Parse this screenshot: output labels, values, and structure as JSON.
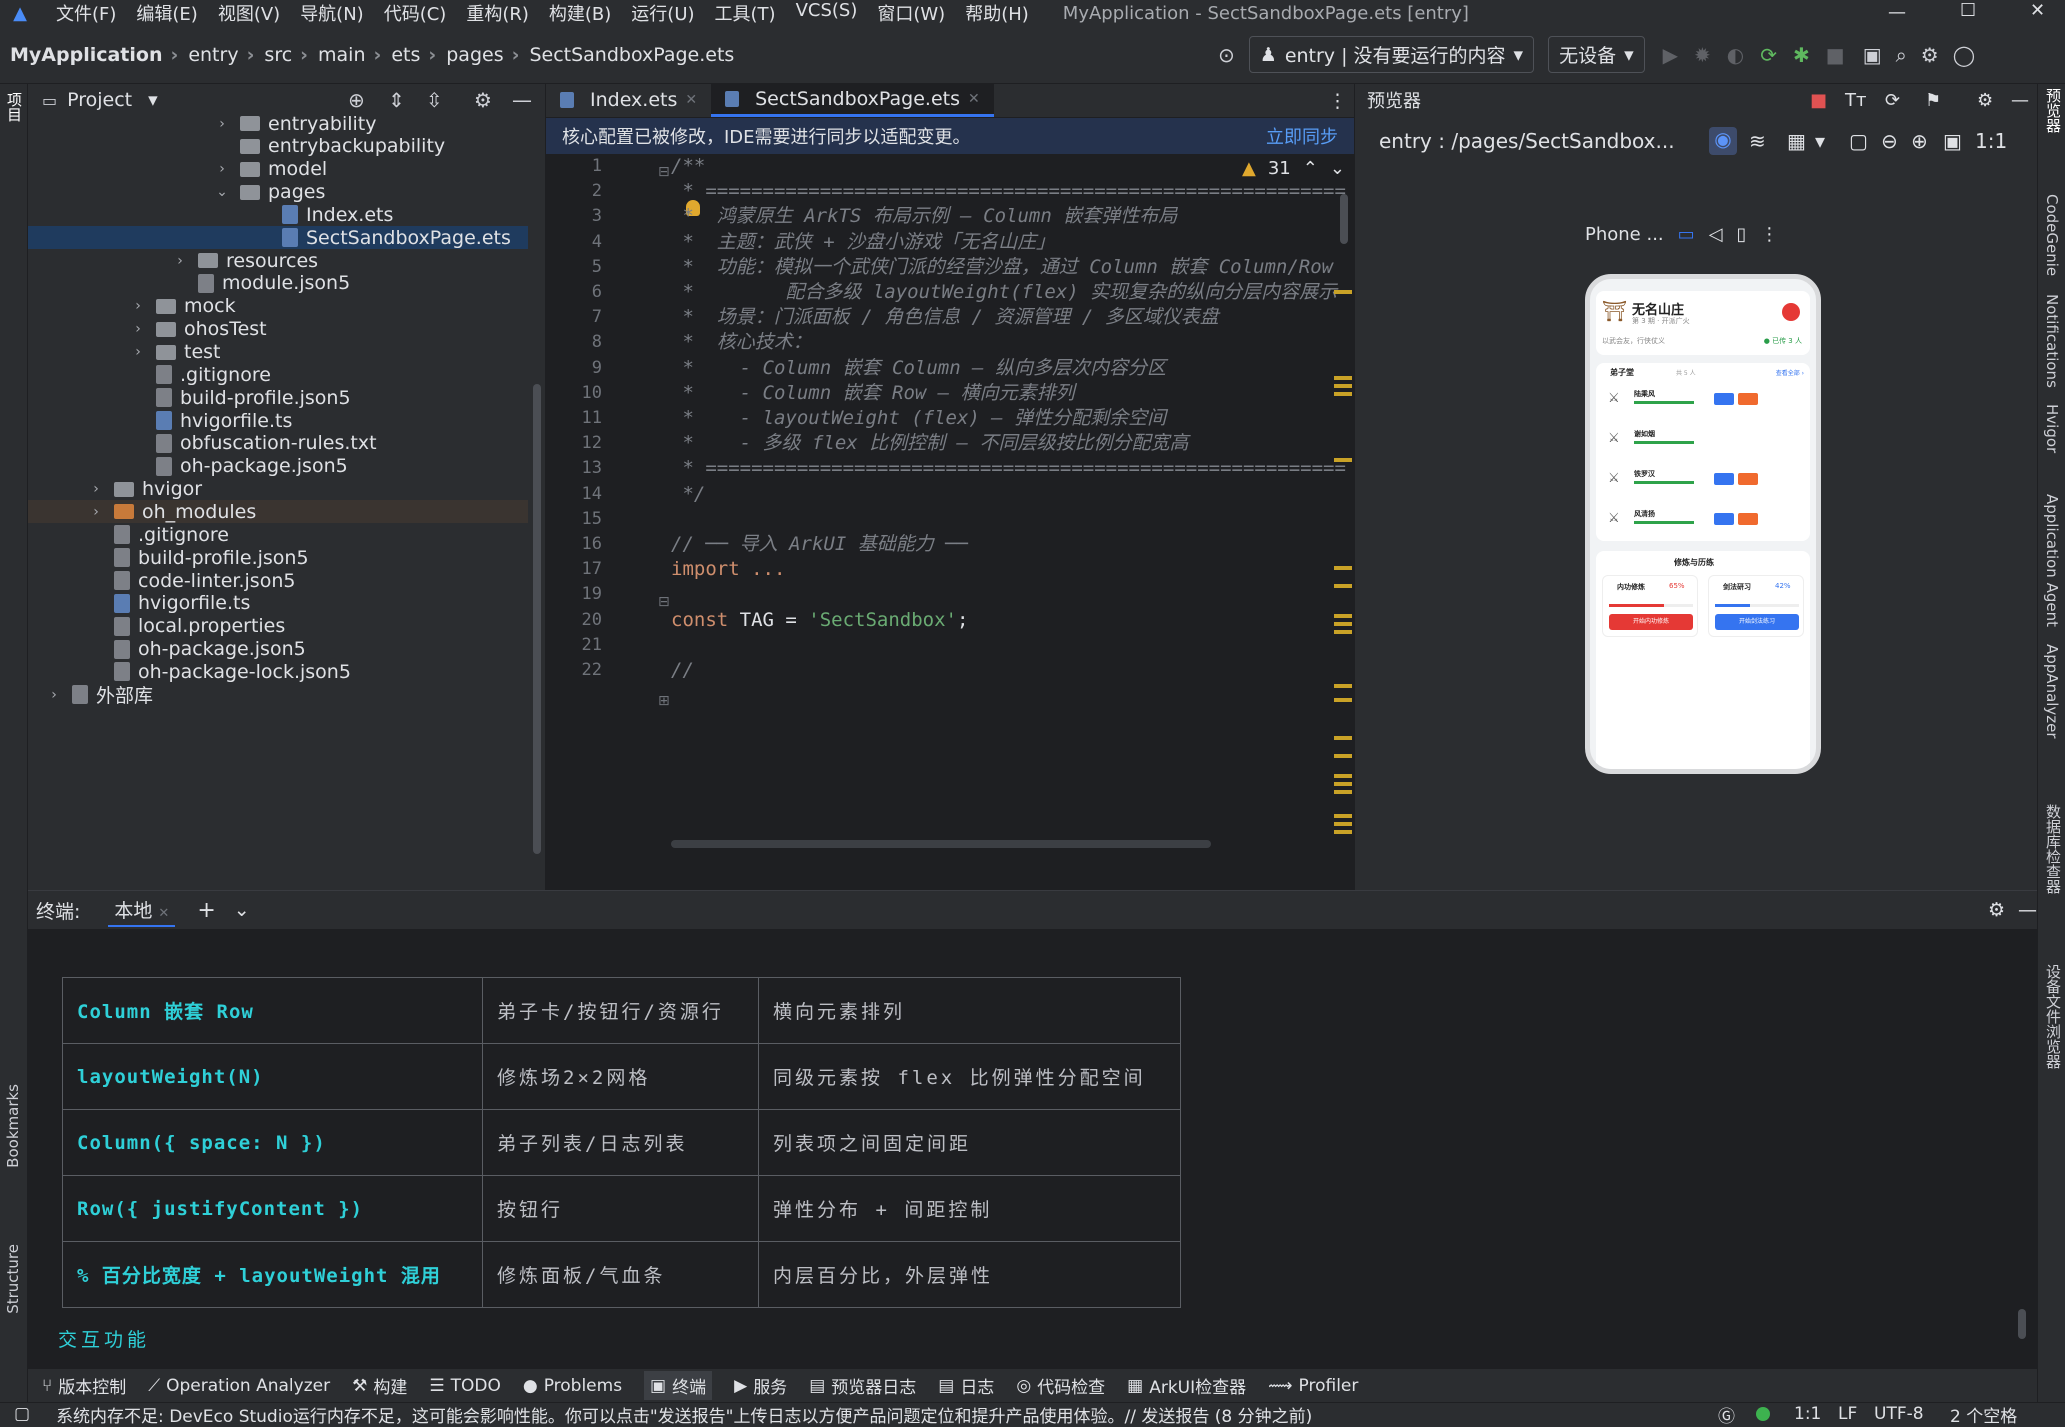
{
  "title_bar": {
    "menus": [
      "文件(F)",
      "编辑(E)",
      "视图(V)",
      "导航(N)",
      "代码(C)",
      "重构(R)",
      "构建(B)",
      "运行(U)",
      "工具(T)",
      "VCS(S)",
      "窗口(W)",
      "帮助(H)"
    ],
    "window_title": "MyApplication - SectSandboxPage.ets [entry]"
  },
  "nav_bar": {
    "breadcrumbs": [
      "MyApplication",
      "entry",
      "src",
      "main",
      "ets",
      "pages",
      "SectSandboxPage.ets"
    ],
    "run_config": "entry | 没有要运行的内容",
    "device": "无设备"
  },
  "left_strip": {
    "project_label": "项目",
    "bookmarks_label": "Bookmarks",
    "structure_label": "Structure"
  },
  "right_strip": {
    "items": [
      "预览器",
      "CodeGenie",
      "Notifications",
      "Hvigor",
      "Application Agent",
      "AppAnalyzer",
      "数据库检查器",
      "设备文件浏览器"
    ]
  },
  "project_panel": {
    "title": "Project",
    "tree": [
      {
        "label": "entryability",
        "type": "folder",
        "depth": 3,
        "expanded": false
      },
      {
        "label": "entrybackupability",
        "type": "folder",
        "depth": 3,
        "expanded": null
      },
      {
        "label": "model",
        "type": "folder",
        "depth": 3,
        "expanded": false
      },
      {
        "label": "pages",
        "type": "folder",
        "depth": 3,
        "expanded": true
      },
      {
        "label": "Index.ets",
        "type": "file",
        "depth": 4
      },
      {
        "label": "SectSandboxPage.ets",
        "type": "file",
        "depth": 4,
        "selected": true
      },
      {
        "label": "resources",
        "type": "folder",
        "depth": 2,
        "expanded": false
      },
      {
        "label": "module.json5",
        "type": "file-g",
        "depth": 2
      },
      {
        "label": "mock",
        "type": "folder",
        "depth": 1,
        "expanded": false
      },
      {
        "label": "ohosTest",
        "type": "folder",
        "depth": 1,
        "expanded": false
      },
      {
        "label": "test",
        "type": "folder",
        "depth": 1,
        "expanded": false
      },
      {
        "label": ".gitignore",
        "type": "file-g",
        "depth": 1
      },
      {
        "label": "build-profile.json5",
        "type": "file-g",
        "depth": 1
      },
      {
        "label": "hvigorfile.ts",
        "type": "file",
        "depth": 1
      },
      {
        "label": "obfuscation-rules.txt",
        "type": "file-g",
        "depth": 1
      },
      {
        "label": "oh-package.json5",
        "type": "file-g",
        "depth": 1
      },
      {
        "label": "hvigor",
        "type": "folder",
        "depth": 0,
        "expanded": false
      },
      {
        "label": "oh_modules",
        "type": "folder-o",
        "depth": 0,
        "expanded": false,
        "highlight": true
      },
      {
        "label": ".gitignore",
        "type": "file-g",
        "depth": 0
      },
      {
        "label": "build-profile.json5",
        "type": "file-g",
        "depth": 0
      },
      {
        "label": "code-linter.json5",
        "type": "file-g",
        "depth": 0
      },
      {
        "label": "hvigorfile.ts",
        "type": "file",
        "depth": 0
      },
      {
        "label": "local.properties",
        "type": "file-g",
        "depth": 0
      },
      {
        "label": "oh-package.json5",
        "type": "file-g",
        "depth": 0
      },
      {
        "label": "oh-package-lock.json5",
        "type": "file-g",
        "depth": 0
      },
      {
        "label": "外部库",
        "type": "lib",
        "depth": -1,
        "expanded": false
      }
    ]
  },
  "editor": {
    "tabs": [
      "Index.ets",
      "SectSandboxPage.ets"
    ],
    "active_tab": 1,
    "banner_text": "核心配置已被修改，IDE需要进行同步以适配变更。",
    "banner_action": "立即同步",
    "warning_count": "31",
    "line_numbers": [
      "1",
      "2",
      "3",
      "4",
      "5",
      "6",
      "7",
      "8",
      "9",
      "10",
      "11",
      "12",
      "13",
      "14",
      "15",
      "16",
      "17",
      "19",
      "20",
      "21",
      "22"
    ],
    "lines": [
      "/**",
      " * ========================================================",
      " *  鸿蒙原生 ArkTS 布局示例 — Column 嵌套弹性布局",
      " *  主题：武侠 + 沙盘小游戏「无名山庄」",
      " *  功能：模拟一个武侠门派的经营沙盘，通过 Column 嵌套 Column/Row",
      " *        配合多级 layoutWeight(flex) 实现复杂的纵向分层内容展示",
      " *  场景：门派面板 / 角色信息 / 资源管理 / 多区域仪表盘",
      " *  核心技术：",
      " *    - Column 嵌套 Column — 纵向多层次内容分区",
      " *    - Column 嵌套 Row — 横向元素排列",
      " *    - layoutWeight (flex) — 弹性分配剩余空间",
      " *    - 多级 flex 比例控制 — 不同层级按比例分配宽高",
      " * ========================================================",
      " */",
      "",
      "// ── 导入 ArkUI 基础能力 ──",
      "import ...",
      "",
      "const TAG = 'SectSandbox';",
      "",
      "//"
    ]
  },
  "preview": {
    "title": "预览器",
    "path": "entry : /pages/SectSandbox...",
    "device_label": "Phone ...",
    "zoom": "1:1",
    "app": {
      "sect_name": "无名山庄",
      "sect_sub": "第 3 期 · 开派广火",
      "sect_motto": "以武会友，行侠仗义",
      "online": "● 已传 3 人",
      "disciples_title": "弟子堂",
      "disciples_count": "共 5 人",
      "disciples_link": "查看全部 ›",
      "disciples": [
        "陆乘风",
        "谢如烟",
        "铁罗汉",
        "风清扬"
      ],
      "training_title": "修炼与历练",
      "train_a": "内功修炼",
      "train_a_pct": "65%",
      "train_a_btn": "开始内功修炼",
      "train_b": "剑法研习",
      "train_b_pct": "42%",
      "train_b_btn": "开始剑法练习"
    }
  },
  "terminal": {
    "title": "终端:",
    "tab": "本地",
    "rows": [
      [
        "Column 嵌套 Row",
        "弟子卡/按钮行/资源行",
        "横向元素排列"
      ],
      [
        "layoutWeight(N)",
        "修炼场2×2网格",
        "同级元素按 flex 比例弹性分配空间"
      ],
      [
        "Column({ space: N })",
        "弟子列表/日志列表",
        "列表项之间固定间距"
      ],
      [
        "Row({ justifyContent })",
        "按钮行",
        "弹性分布 + 间距控制"
      ],
      [
        "% 百分比宽度 + layoutWeight 混用",
        "修炼面板/气血条",
        "内层百分比，外层弹性"
      ]
    ],
    "section_heading": "交互功能"
  },
  "tool_windows": [
    "版本控制",
    "Operation Analyzer",
    "构建",
    "TODO",
    "Problems",
    "终端",
    "服务",
    "预览器日志",
    "日志",
    "代码检查",
    "ArkUI检查器",
    "Profiler"
  ],
  "status_bar": {
    "message": "系统内存不足: DevEco Studio运行内存不足，这可能会影响性能。你可以点击\"发送报告\"上传日志以方便产品问题定位和提升产品使用体验。// 发送报告 (8 分钟之前)",
    "position": "1:1",
    "line_sep": "LF",
    "encoding": "UTF-8",
    "indent": "2 个空格"
  },
  "colors": {
    "accent": "#3574f0",
    "bg": "#2b2d30",
    "editor_bg": "#1e1f22",
    "terminal_cyan": "#2fd0d8",
    "warning": "#e0a82e"
  }
}
